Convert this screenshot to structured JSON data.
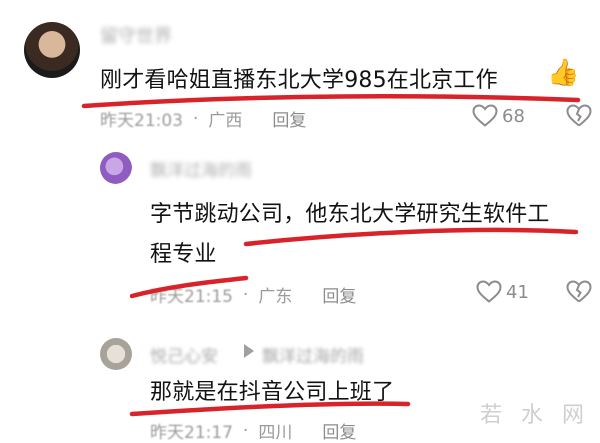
{
  "comments": [
    {
      "username": "留守世界",
      "text": "刚才看哈姐直播东北大学985在北京工作",
      "emoji": "👍",
      "time": "昨天21:03",
      "location": "广西",
      "reply_label": "回复",
      "likes": "68"
    },
    {
      "username": "飘洋过海的雨",
      "text_line1": "字节跳动公司，他东北大学研究生软件工",
      "text_line2": "程专业",
      "time": "昨天21:15",
      "location": "广东",
      "reply_label": "回复",
      "likes": "41"
    },
    {
      "username": "悦己心安",
      "reply_to": "飘洋过海的雨",
      "text": "那就是在抖音公司上班了",
      "time": "昨天21:17",
      "location": "四川",
      "reply_label": "回复"
    }
  ],
  "watermark": "若 水 网",
  "colors": {
    "underline": "#d8232a",
    "meta": "#9a9a9a"
  }
}
